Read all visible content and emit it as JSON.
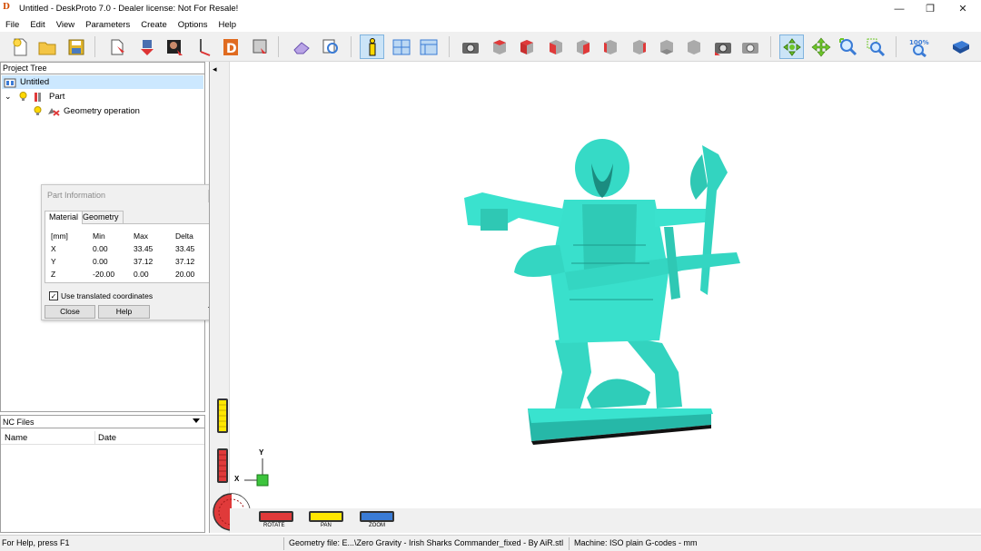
{
  "window": {
    "title": "Untitled - DeskProto 7.0 - Dealer license: Not For Resale!",
    "logo_text": "D",
    "controls": {
      "minimize": "—",
      "restore": "❐",
      "close": "✕"
    }
  },
  "menu": [
    "File",
    "Edit",
    "View",
    "Parameters",
    "Create",
    "Options",
    "Help"
  ],
  "toolbar": {
    "zoom_level": "100%",
    "colors": {
      "teal": "#33e0d0",
      "red": "#e03a3a",
      "yellow": "#ffe600",
      "blue": "#3a7bd5",
      "green": "#3cb043"
    }
  },
  "project_tree": {
    "header": "Project Tree",
    "items": [
      {
        "label": "Untitled"
      },
      {
        "label": "Part"
      },
      {
        "label": "Geometry operation"
      }
    ]
  },
  "part_info": {
    "title": "Part Information",
    "tabs": [
      "Material",
      "Geometry"
    ],
    "table": {
      "header": [
        "[mm]",
        "Min",
        "Max",
        "Delta"
      ],
      "rows": [
        [
          "X",
          "0.00",
          "33.45",
          "33.45"
        ],
        [
          "Y",
          "0.00",
          "37.12",
          "37.12"
        ],
        [
          "Z",
          "-20.00",
          "0.00",
          "20.00"
        ]
      ]
    },
    "checkbox_label": "Use translated coordinates",
    "checkbox_checked": "✓",
    "buttons": {
      "close": "Close",
      "help": "Help"
    }
  },
  "nc_files": {
    "header": "NC Files",
    "columns": [
      "Name",
      "Date"
    ]
  },
  "viewport": {
    "model_color": "#33ddc8",
    "axis_labels": {
      "x": "X",
      "y": "Y"
    },
    "mouse_modes": [
      "ROTATE",
      "PAN",
      "ZOOM"
    ],
    "collapse_arrow": "◂"
  },
  "status": {
    "help": "For Help, press F1",
    "geometry_file": "Geometry file: E...\\Zero Gravity - Irish Sharks Commander_fixed - By AiR.stl",
    "machine": "Machine: ISO plain G-codes - mm"
  }
}
